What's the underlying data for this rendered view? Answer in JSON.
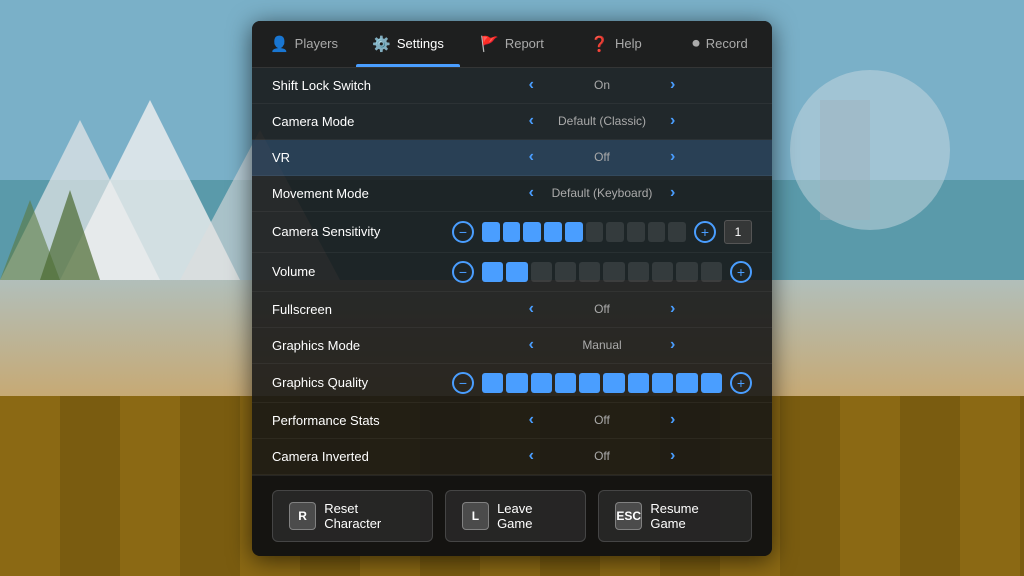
{
  "background": {
    "sky_color": "#7ab0c8",
    "floor_color": "#8b6914"
  },
  "tabs": [
    {
      "id": "players",
      "label": "Players",
      "icon": "👤",
      "active": false
    },
    {
      "id": "settings",
      "label": "Settings",
      "icon": "⚙️",
      "active": true
    },
    {
      "id": "report",
      "label": "Report",
      "icon": "🚩",
      "active": false
    },
    {
      "id": "help",
      "label": "Help",
      "icon": "❓",
      "active": false
    },
    {
      "id": "record",
      "label": "Record",
      "icon": "⏺",
      "active": false
    }
  ],
  "settings": [
    {
      "id": "shift-lock",
      "label": "Shift Lock Switch",
      "type": "toggle",
      "value": "On",
      "highlighted": false
    },
    {
      "id": "camera-mode",
      "label": "Camera Mode",
      "type": "toggle",
      "value": "Default (Classic)",
      "highlighted": false
    },
    {
      "id": "vr",
      "label": "VR",
      "type": "toggle",
      "value": "Off",
      "highlighted": true
    },
    {
      "id": "movement-mode",
      "label": "Movement Mode",
      "type": "toggle",
      "value": "Default (Keyboard)",
      "highlighted": false
    },
    {
      "id": "camera-sensitivity",
      "label": "Camera Sensitivity",
      "type": "slider",
      "filled": 5,
      "total": 10,
      "show_number": true,
      "number": "1",
      "highlighted": false
    },
    {
      "id": "volume",
      "label": "Volume",
      "type": "slider",
      "filled": 2,
      "total": 10,
      "show_number": false,
      "highlighted": false
    },
    {
      "id": "fullscreen",
      "label": "Fullscreen",
      "type": "toggle",
      "value": "Off",
      "highlighted": false
    },
    {
      "id": "graphics-mode",
      "label": "Graphics Mode",
      "type": "toggle",
      "value": "Manual",
      "highlighted": false
    },
    {
      "id": "graphics-quality",
      "label": "Graphics Quality",
      "type": "slider",
      "filled": 10,
      "total": 10,
      "show_number": false,
      "highlighted": false
    },
    {
      "id": "performance-stats",
      "label": "Performance Stats",
      "type": "toggle",
      "value": "Off",
      "highlighted": false
    },
    {
      "id": "camera-inverted",
      "label": "Camera Inverted",
      "type": "toggle",
      "value": "Off",
      "highlighted": false
    }
  ],
  "bottom_buttons": [
    {
      "id": "reset-character",
      "key": "R",
      "label": "Reset Character"
    },
    {
      "id": "leave-game",
      "key": "L",
      "label": "Leave Game"
    },
    {
      "id": "resume-game",
      "key": "ESC",
      "label": "Resume Game"
    }
  ]
}
